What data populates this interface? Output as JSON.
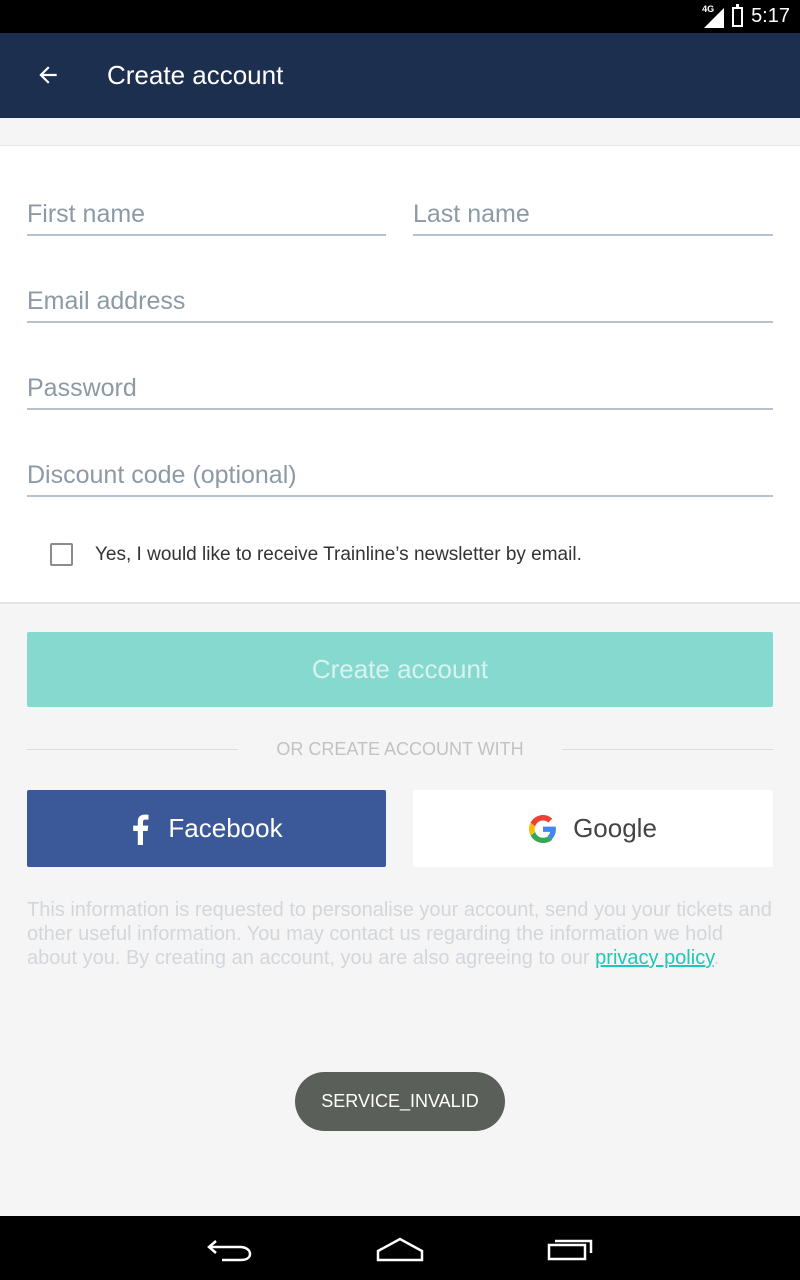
{
  "status_bar": {
    "time": "5:17",
    "network_label": "4G",
    "icons": [
      "signal-icon",
      "battery-icon"
    ]
  },
  "app_bar": {
    "title": "Create account",
    "back_icon": "arrow-left-icon",
    "background_color": "#1d2f4f"
  },
  "form": {
    "first_name": {
      "placeholder": "First name",
      "value": ""
    },
    "last_name": {
      "placeholder": "Last name",
      "value": ""
    },
    "email": {
      "placeholder": "Email address",
      "value": ""
    },
    "password": {
      "placeholder": "Password",
      "value": ""
    },
    "discount_code": {
      "placeholder": "Discount code (optional)",
      "value": ""
    },
    "newsletter": {
      "label": "Yes, I would like to receive Trainline’s newsletter by email.",
      "checked": false
    }
  },
  "actions": {
    "create_account_label": "Create account",
    "create_account_color": "#86d9cf",
    "or_text": "OR CREATE ACCOUNT WITH",
    "facebook_label": "Facebook",
    "facebook_color": "#3b5998",
    "google_label": "Google"
  },
  "info": {
    "text": "This information is requested to personalise your account, send you your tickets and other useful information. You may contact us regarding the information we hold about you. By creating an account, you are also agreeing to our ",
    "link_label": "privacy policy",
    "suffix": ".",
    "link_color": "#1ec8b6"
  },
  "toast": {
    "message": "SERVICE_INVALID"
  },
  "nav_bar": {
    "buttons": [
      "back-icon",
      "home-icon",
      "recents-icon"
    ]
  }
}
